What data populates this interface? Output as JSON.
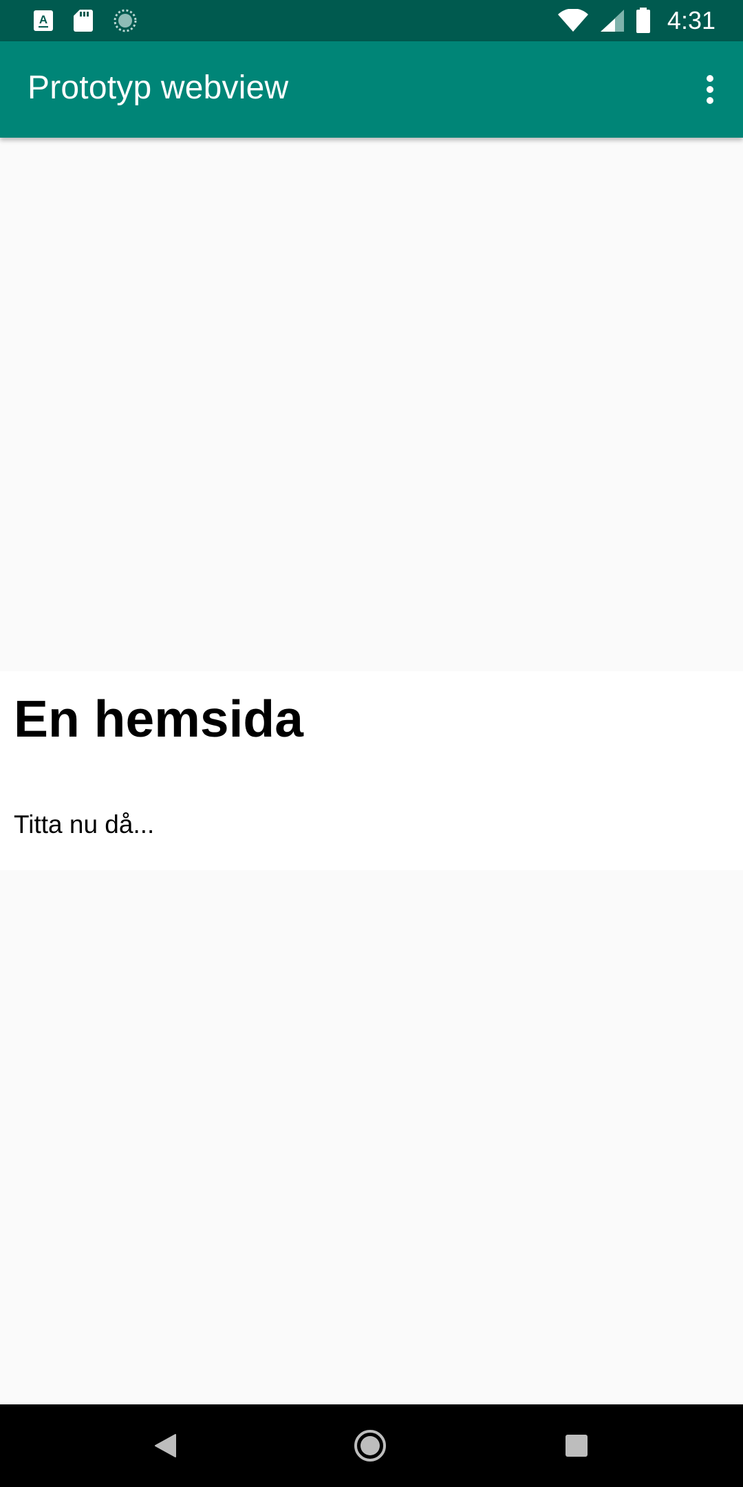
{
  "status_bar": {
    "time": "4:31",
    "left_icons": [
      "a-text-icon",
      "sd-card-icon",
      "sync-spinner-icon"
    ],
    "right_icons": [
      "wifi-icon",
      "cell-signal-icon",
      "battery-icon"
    ]
  },
  "app_bar": {
    "title": "Prototyp webview",
    "menu_icon": "more-vert-icon",
    "background_color": "#008577",
    "status_color": "#005a4f"
  },
  "webview": {
    "heading": "En hemsida",
    "paragraph": "Titta nu då..."
  },
  "nav_bar": {
    "buttons": [
      "back-icon",
      "home-icon",
      "recents-icon"
    ]
  }
}
